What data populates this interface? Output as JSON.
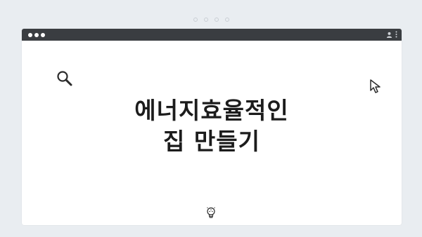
{
  "title": {
    "line1": "에너지효율적인",
    "line2": "집 만들기"
  },
  "icons": {
    "search": "search-icon",
    "cursor": "cursor-icon",
    "bulb": "lightbulb-icon",
    "user": "user-icon",
    "menu": "more-vertical-icon"
  },
  "colors": {
    "background": "#e9edf1",
    "titlebar": "#3a3d41",
    "window": "#ffffff",
    "text": "#1c1c1c"
  }
}
